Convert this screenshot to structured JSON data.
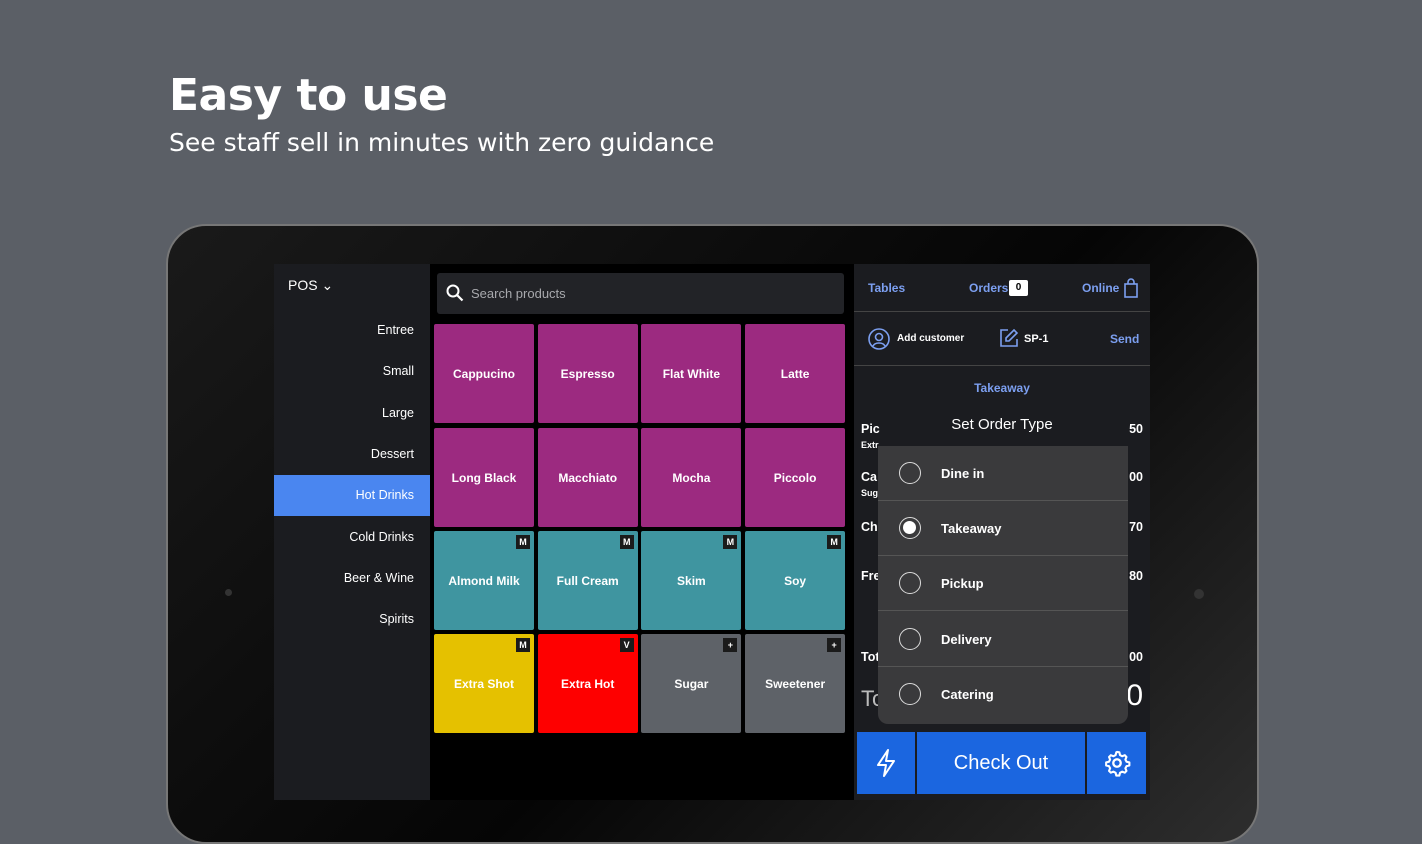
{
  "hero": {
    "title": "Easy to use",
    "subtitle": "See staff sell in minutes with zero guidance"
  },
  "sidebar": {
    "menu_label": "POS ⌄",
    "categories": [
      "Entree",
      "Small",
      "Large",
      "Dessert",
      "Hot Drinks",
      "Cold Drinks",
      "Beer & Wine",
      "Spirits"
    ],
    "active": "Hot Drinks"
  },
  "search": {
    "placeholder": "Search products"
  },
  "products": [
    {
      "name": "Cappucino",
      "color": "#9c2a80",
      "badge": ""
    },
    {
      "name": "Espresso",
      "color": "#9c2a80",
      "badge": ""
    },
    {
      "name": "Flat White",
      "color": "#9c2a80",
      "badge": ""
    },
    {
      "name": "Latte",
      "color": "#9c2a80",
      "badge": ""
    },
    {
      "name": "Long Black",
      "color": "#9c2a80",
      "badge": ""
    },
    {
      "name": "Macchiato",
      "color": "#9c2a80",
      "badge": ""
    },
    {
      "name": "Mocha",
      "color": "#9c2a80",
      "badge": ""
    },
    {
      "name": "Piccolo",
      "color": "#9c2a80",
      "badge": ""
    },
    {
      "name": "Almond Milk",
      "color": "#3f95a0",
      "badge": "M"
    },
    {
      "name": "Full Cream",
      "color": "#3f95a0",
      "badge": "M"
    },
    {
      "name": "Skim",
      "color": "#3f95a0",
      "badge": "M"
    },
    {
      "name": "Soy",
      "color": "#3f95a0",
      "badge": "M"
    },
    {
      "name": "Extra Shot",
      "color": "#e5c100",
      "badge": "M"
    },
    {
      "name": "Extra Hot",
      "color": "#fe0000",
      "badge": "V"
    },
    {
      "name": "Sugar",
      "color": "#5e6268",
      "badge": "+"
    },
    {
      "name": "Sweetener",
      "color": "#5e6268",
      "badge": "+"
    }
  ],
  "panel": {
    "tables": "Tables",
    "orders": "Orders",
    "orders_count": "0",
    "online": "Online",
    "add_customer": "Add customer",
    "order_id": "SP-1",
    "send": "Send",
    "order_type": "Takeaway",
    "fragments_left": [
      "Pic",
      "Extr",
      "Ca",
      "Sug",
      "Ch",
      "Fre",
      "Tot",
      "To"
    ],
    "fragments_right": [
      "50",
      "00",
      "70",
      "80",
      "00",
      "0"
    ]
  },
  "modal": {
    "title": "Set Order Type",
    "options": [
      "Dine in",
      "Takeaway",
      "Pickup",
      "Delivery",
      "Catering"
    ],
    "selected": "Takeaway"
  },
  "footer": {
    "checkout": "Check Out"
  }
}
